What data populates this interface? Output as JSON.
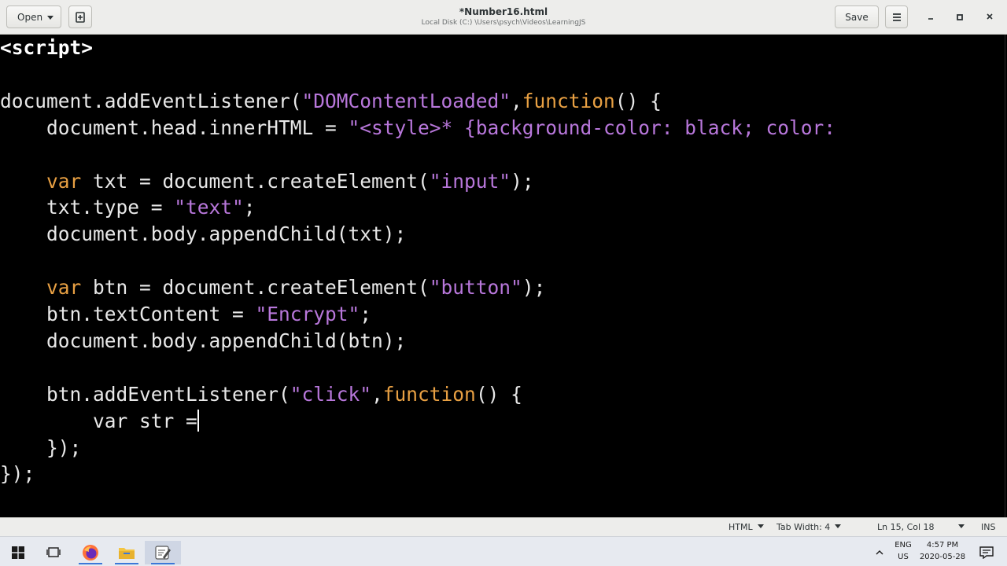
{
  "header": {
    "open_label": "Open",
    "title": "*Number16.html",
    "subtitle": "Local Disk (C:) \\Users\\psych\\Videos\\LearningJS",
    "save_label": "Save",
    "icons": [
      "new-tab-icon",
      "hamburger-menu-icon",
      "minimize-icon",
      "maximize-icon",
      "close-icon"
    ]
  },
  "code": {
    "lines": [
      {
        "segments": [
          {
            "t": "<script>",
            "c": "tag"
          }
        ]
      },
      {
        "segments": []
      },
      {
        "segments": [
          {
            "t": "document.addEventListener(",
            "c": "plain"
          },
          {
            "t": "\"DOMContentLoaded\"",
            "c": "str"
          },
          {
            "t": ",",
            "c": "plain"
          },
          {
            "t": "function",
            "c": "kw"
          },
          {
            "t": "() {",
            "c": "plain"
          }
        ]
      },
      {
        "segments": [
          {
            "t": "    document.head.innerHTML = ",
            "c": "plain"
          },
          {
            "t": "\"<style>* {background-color: black; color:",
            "c": "str"
          }
        ]
      },
      {
        "segments": []
      },
      {
        "segments": [
          {
            "t": "    ",
            "c": "plain"
          },
          {
            "t": "var",
            "c": "kw"
          },
          {
            "t": " txt = document.createElement(",
            "c": "plain"
          },
          {
            "t": "\"input\"",
            "c": "str"
          },
          {
            "t": ");",
            "c": "plain"
          }
        ]
      },
      {
        "segments": [
          {
            "t": "    txt.type = ",
            "c": "plain"
          },
          {
            "t": "\"text\"",
            "c": "str"
          },
          {
            "t": ";",
            "c": "plain"
          }
        ]
      },
      {
        "segments": [
          {
            "t": "    document.body.appendChild(txt);",
            "c": "plain"
          }
        ]
      },
      {
        "segments": []
      },
      {
        "segments": [
          {
            "t": "    ",
            "c": "plain"
          },
          {
            "t": "var",
            "c": "kw"
          },
          {
            "t": " btn = document.createElement(",
            "c": "plain"
          },
          {
            "t": "\"button\"",
            "c": "str"
          },
          {
            "t": ");",
            "c": "plain"
          }
        ]
      },
      {
        "segments": [
          {
            "t": "    btn.textContent = ",
            "c": "plain"
          },
          {
            "t": "\"Encrypt\"",
            "c": "str"
          },
          {
            "t": ";",
            "c": "plain"
          }
        ]
      },
      {
        "segments": [
          {
            "t": "    document.body.appendChild(btn);",
            "c": "plain"
          }
        ]
      },
      {
        "segments": []
      },
      {
        "segments": [
          {
            "t": "    btn.addEventListener(",
            "c": "plain"
          },
          {
            "t": "\"click\"",
            "c": "str"
          },
          {
            "t": ",",
            "c": "plain"
          },
          {
            "t": "function",
            "c": "kw"
          },
          {
            "t": "() {",
            "c": "plain"
          }
        ]
      },
      {
        "segments": [
          {
            "t": "        var str =",
            "c": "plain"
          }
        ],
        "cursor": true
      },
      {
        "segments": [
          {
            "t": "    });",
            "c": "plain"
          }
        ]
      },
      {
        "segments": [
          {
            "t": "});",
            "c": "plain"
          }
        ]
      }
    ],
    "colors": {
      "plain": "#e8e8e8",
      "tag": "#ffffff",
      "string": "#b877db",
      "keyword": "#e8a043",
      "background": "#000000"
    }
  },
  "statusbar": {
    "language": "HTML",
    "tab_width": "Tab Width: 4",
    "position": "Ln 15, Col 18",
    "mode": "INS"
  },
  "taskbar": {
    "apps": [
      "windows-start-icon",
      "task-view-icon",
      "firefox-icon",
      "file-explorer-icon",
      "text-editor-icon"
    ],
    "lang_top": "ENG",
    "lang_bottom": "US",
    "time": "4:57 PM",
    "date": "2020-05-28"
  }
}
